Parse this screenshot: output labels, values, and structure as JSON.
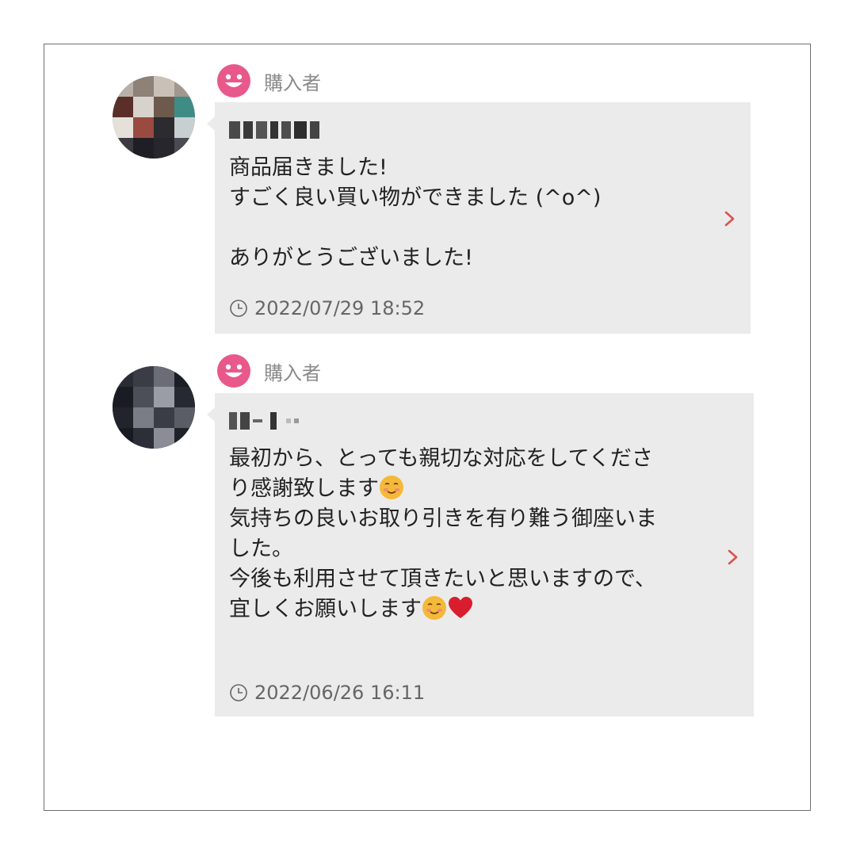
{
  "reviews": [
    {
      "role_label": "購入者",
      "message": "商品届きました!\nすごく良い買い物ができました (^o^)\n\nありがとうございました!",
      "timestamp": "2022/07/29 18:52"
    },
    {
      "role_label": "購入者",
      "message_lines": [
        "最初から、とっても親切な対応をしてくださ",
        "り感謝致します",
        "気持ちの良いお取り引きを有り難う御座いま",
        "した。",
        "今後も利用させて頂きたいと思いますので、",
        "宜しくお願いします"
      ],
      "timestamp": "2022/06/26 16:11"
    }
  ],
  "icons": {
    "role": "smiley-face-icon",
    "time": "clock-icon",
    "more": "chevron-right-icon",
    "emoji_smile": "smiling-face-emoji",
    "emoji_heart": "red-heart-emoji"
  },
  "colors": {
    "accent_pink": "#e8588a",
    "bubble_bg": "#ebebeb",
    "chevron_red": "#d9534f",
    "muted_text": "#8a8a8a"
  }
}
